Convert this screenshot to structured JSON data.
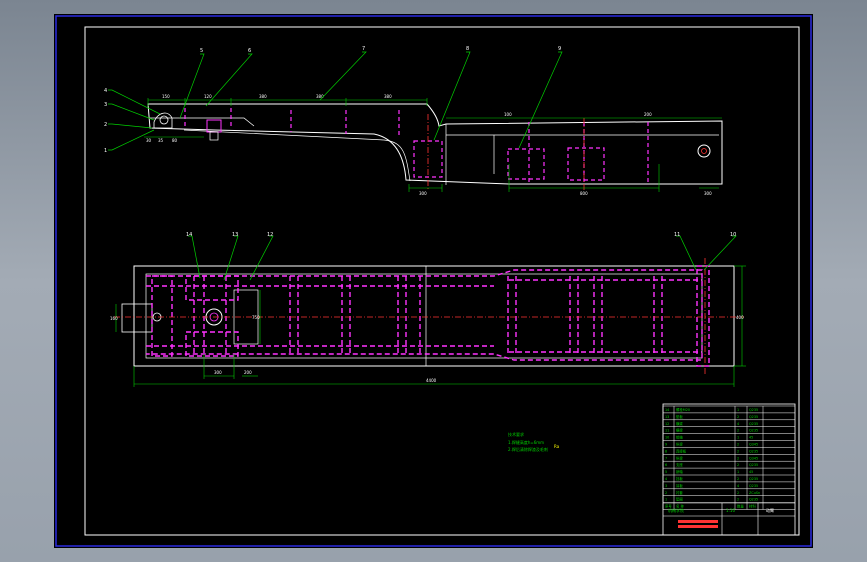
{
  "balloons": [
    "1",
    "2",
    "3",
    "4",
    "5",
    "6",
    "7",
    "8",
    "9",
    "10",
    "11",
    "12",
    "13",
    "14"
  ],
  "dims": {
    "side_top": [
      "150",
      "120",
      "380",
      "380",
      "380"
    ],
    "side_left": [
      "30",
      "35",
      "80"
    ],
    "side_mid": [
      "100",
      "200"
    ],
    "side_bottom": [
      "300",
      "800",
      "300"
    ],
    "plan_left": "750",
    "plan_right": "400",
    "plan_side": "160",
    "plan_bottom_a": "300",
    "plan_bottom_b": "200",
    "plan_overall": "4400"
  },
  "notes": {
    "title": "技术要求",
    "line1": "1.焊缝高度h=6mm",
    "line2": "2.焊后清除焊渣及毛刺",
    "tag": "Ra"
  },
  "title_block": {
    "bom_rows": [
      [
        "14",
        "螺栓M20",
        "1",
        "Q235"
      ],
      [
        "13",
        "垫板",
        "2",
        "Q235"
      ],
      [
        "12",
        "横梁",
        "4",
        "Q235"
      ],
      [
        "11",
        "横梁",
        "2",
        "Q235"
      ],
      [
        "10",
        "销轴",
        "1",
        "45"
      ],
      [
        "9",
        "纵梁",
        "2",
        "Q345"
      ],
      [
        "8",
        "连接板",
        "2",
        "Q235"
      ],
      [
        "7",
        "纵梁",
        "2",
        "Q345"
      ],
      [
        "6",
        "支座",
        "2",
        "Q235"
      ],
      [
        "5",
        "销轴",
        "1",
        "45"
      ],
      [
        "4",
        "挡板",
        "2",
        "Q235"
      ],
      [
        "3",
        "耳板",
        "4",
        "Q235"
      ],
      [
        "2",
        "衬套",
        "2",
        "ZCuSn"
      ],
      [
        "1",
        "垫圈",
        "2",
        "Q235"
      ]
    ],
    "header": [
      "序号",
      "名 称",
      "数量",
      "材料"
    ],
    "scale": "1:10",
    "drawing_name": "动臂",
    "company": "机械学院"
  }
}
